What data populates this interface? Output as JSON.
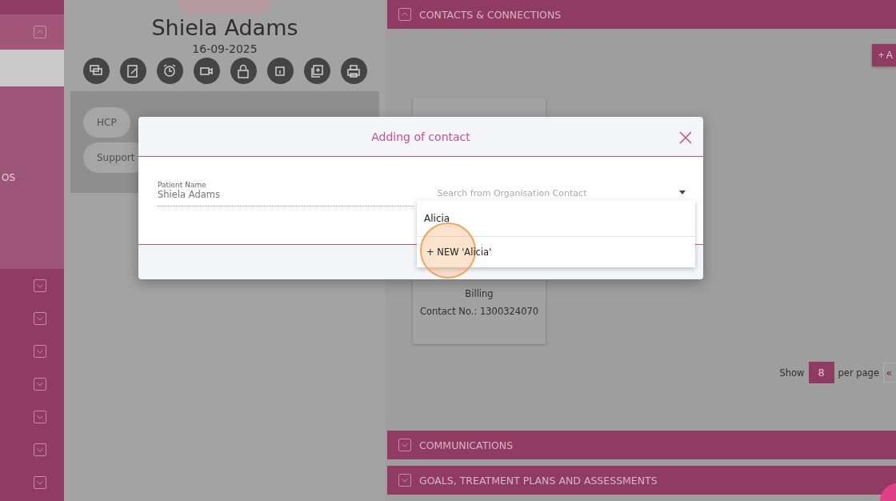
{
  "sidebar": {
    "top_section": {
      "expanded": true
    },
    "label": "OS",
    "collapsed_sections": [
      {
        "expanded": false
      },
      {
        "expanded": false
      },
      {
        "expanded": false
      },
      {
        "expanded": false
      },
      {
        "expanded": false
      },
      {
        "expanded": false
      },
      {
        "expanded": false
      }
    ]
  },
  "profile": {
    "name": "Shiela Adams",
    "date": "16-09-2025",
    "tags": [
      "HCP",
      "Support"
    ]
  },
  "sections_top": [
    {
      "title": "CONTACTS & CONNECTIONS",
      "expanded": true
    }
  ],
  "add_button": "+ A",
  "contact_card": {
    "lines": [
      "Billing",
      "Contact No.: 1300324070"
    ]
  },
  "pagination": {
    "show_label": "Show",
    "per_page": "8",
    "suffix": "per page",
    "first": "«"
  },
  "sections_bottom": [
    {
      "title": "COMMUNICATIONS",
      "expanded": false
    },
    {
      "title": "GOALS, TREATMENT PLANS AND ASSESSMENTS",
      "expanded": false
    }
  ],
  "modal": {
    "title": "Adding of contact",
    "patient_label": "Patient Name",
    "patient_value": "Shiela Adams",
    "search_placeholder": "Search from Organisation Contact",
    "dropdown": {
      "query": "Alicia",
      "options": [
        {
          "label": "+ NEW 'Alicia'",
          "selected": true
        }
      ]
    }
  }
}
